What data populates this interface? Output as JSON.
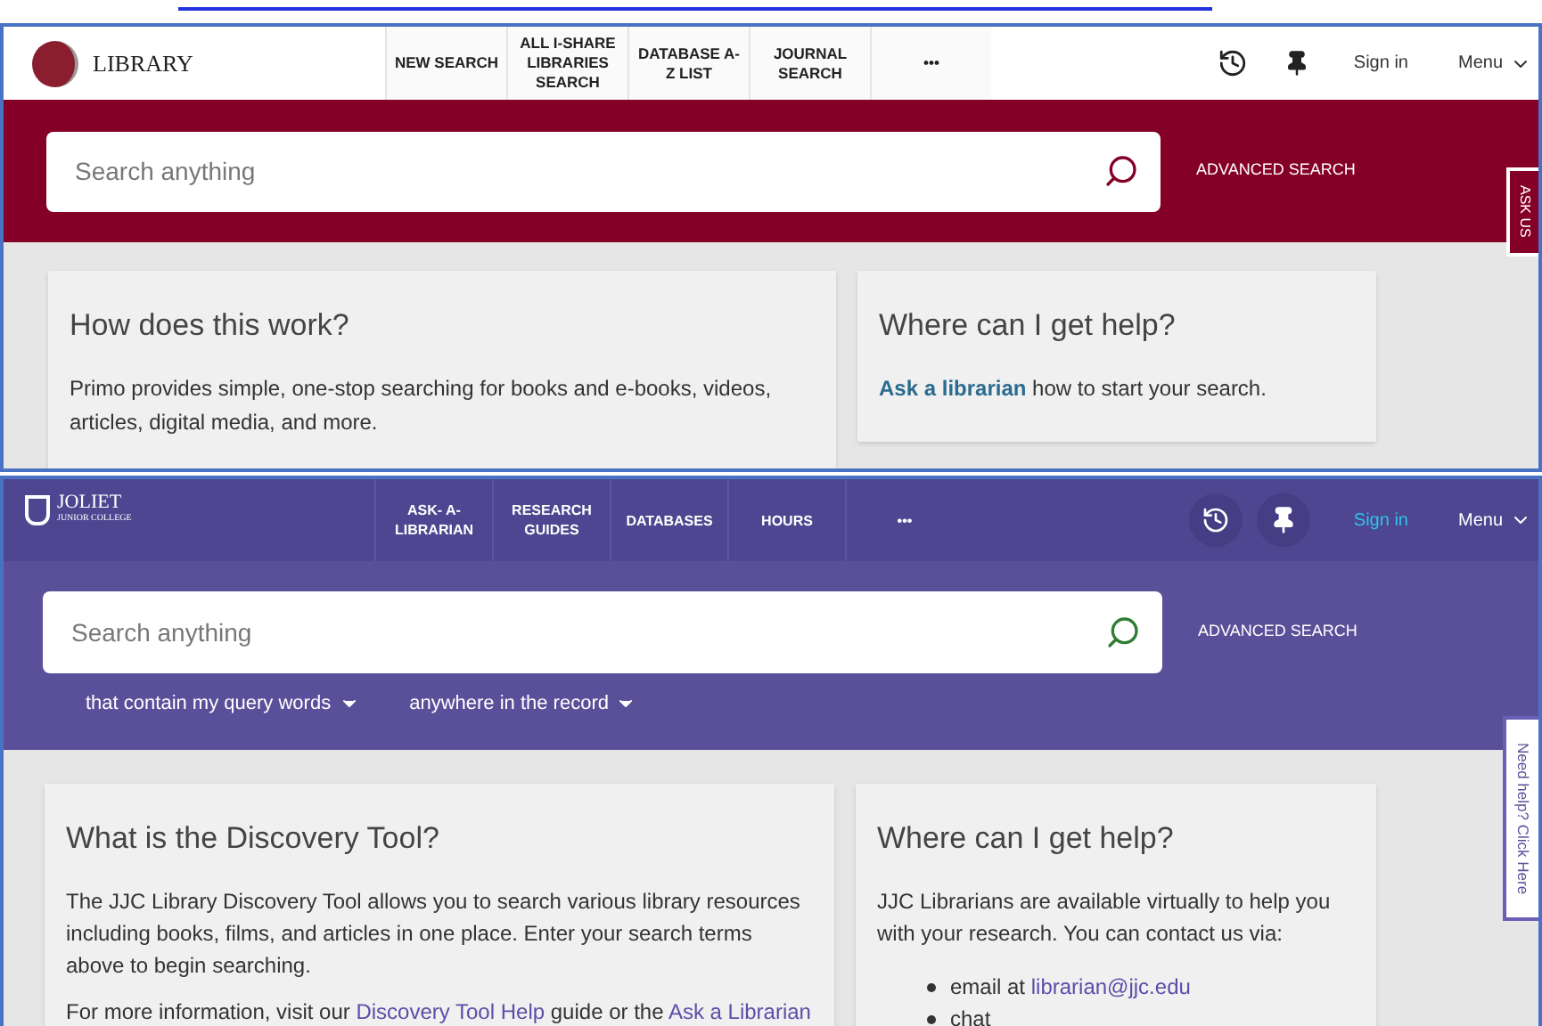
{
  "lewis_page": {
    "logo_text": "LIBRARY",
    "nav": [
      {
        "label": "NEW SEARCH"
      },
      {
        "label": "ALL I-SHARE LIBRARIES SEARCH"
      },
      {
        "label": "DATABASE A-Z LIST"
      },
      {
        "label": "JOURNAL SEARCH"
      },
      {
        "label": "•••"
      }
    ],
    "sign_in": "Sign in",
    "menu": "Menu",
    "search": {
      "placeholder": "Search anything"
    },
    "advanced_search": "ADVANCED SEARCH",
    "side_tab": "ASK US",
    "cards": [
      {
        "title": "How does this work?",
        "paragraphs": [
          [
            {
              "text": "Primo provides simple, one-stop searching for books and e-books, videos, articles, digital media, and more.",
              "link": false
            }
          ]
        ]
      },
      {
        "title": "Where can I get help?",
        "paragraphs": [
          [
            {
              "text": "Ask a librarian",
              "link": true
            },
            {
              "text": " how to start your search.",
              "link": false
            }
          ]
        ]
      }
    ]
  },
  "joliet_page": {
    "logo_text": "JOLIET",
    "logo_subtext": "JUNIOR COLLEGE",
    "nav": [
      {
        "label": "ASK- A-LIBRARIAN"
      },
      {
        "label": "RESEARCH GUIDES"
      },
      {
        "label": "DATABASES"
      },
      {
        "label": "HOURS"
      },
      {
        "label": "•••"
      }
    ],
    "sign_in": "Sign in",
    "menu": "Menu",
    "search": {
      "placeholder": "Search anything"
    },
    "advanced_search": "ADVANCED SEARCH",
    "filters": [
      "that contain my query words",
      "anywhere in the record"
    ],
    "side_tab": "Need help? Click Here",
    "cards": [
      {
        "title": "What is the Discovery Tool?",
        "paragraphs": [
          [
            {
              "text": "The JJC Library Discovery Tool allows you to search various library resources including books, films, and articles in one place. Enter your search terms above to begin searching.",
              "link": false
            }
          ],
          [
            {
              "text": "For more information, visit our ",
              "link": false
            },
            {
              "text": "Discovery Tool Help",
              "link": true
            },
            {
              "text": " guide or the ",
              "link": false
            },
            {
              "text": "Ask a Librarian",
              "link": true
            }
          ]
        ]
      },
      {
        "title": "Where can I get help?",
        "paragraphs": [
          [
            {
              "text": "JJC Librarians are available virtually to help you with your research. You can contact us via:",
              "link": false
            }
          ]
        ],
        "bullets": [
          [
            {
              "text": "email at ",
              "link": false
            },
            {
              "text": "librarian@jjc.edu",
              "link": true
            }
          ],
          [
            {
              "text": "chat",
              "link": false
            }
          ]
        ]
      }
    ]
  }
}
